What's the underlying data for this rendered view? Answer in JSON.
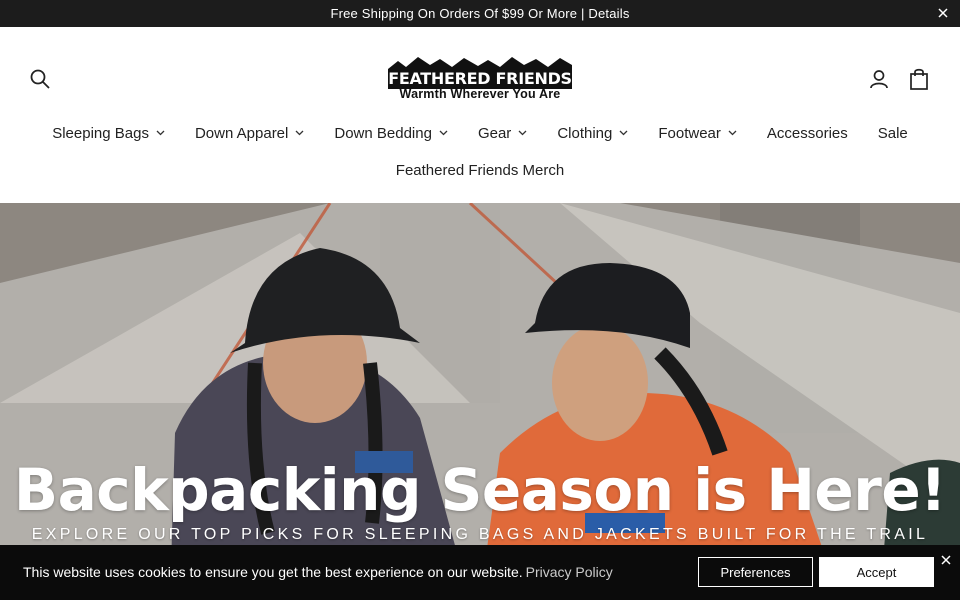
{
  "announcement": {
    "text": "Free Shipping On Orders Of $99 Or More | Details",
    "close_icon": "close-icon"
  },
  "header": {
    "logo_text": "FEATHERED FRIENDS",
    "tagline": "Warmth Wherever You Are",
    "icons": [
      "search-icon",
      "account-icon",
      "cart-icon"
    ]
  },
  "nav": {
    "items": [
      {
        "label": "Sleeping Bags",
        "dropdown": true
      },
      {
        "label": "Down Apparel",
        "dropdown": true
      },
      {
        "label": "Down Bedding",
        "dropdown": true
      },
      {
        "label": "Gear",
        "dropdown": true
      },
      {
        "label": "Clothing",
        "dropdown": true
      },
      {
        "label": "Footwear",
        "dropdown": true
      },
      {
        "label": "Accessories",
        "dropdown": false
      },
      {
        "label": "Sale",
        "dropdown": false
      }
    ],
    "row2": {
      "label": "Feathered Friends Merch"
    }
  },
  "hero": {
    "title": "Backpacking Season is Here!",
    "subtitle": "EXPLORE OUR TOP PICKS FOR SLEEPING BAGS AND JACKETS BUILT FOR THE TRAIL",
    "jacket_label_1": "FEATHERED FRIENDS",
    "jacket_label_2": "FEATHERED FRIENDS"
  },
  "cookie": {
    "text": "This website uses cookies to ensure you get the best experience on our website.",
    "link": "Privacy Policy",
    "preferences": "Preferences",
    "accept": "Accept"
  },
  "colors": {
    "announce_bg": "#1c1c1c",
    "cookie_bg": "#0b0b0b",
    "text": "#222222"
  }
}
